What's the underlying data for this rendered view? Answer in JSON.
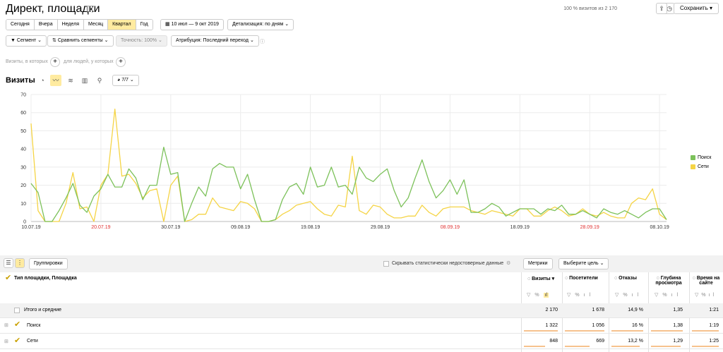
{
  "header": {
    "title": "Директ, площадки",
    "sampling": "100 % визитов из 2 170",
    "save": "Сохранить"
  },
  "periods": [
    "Сегодня",
    "Вчера",
    "Неделя",
    "Месяц",
    "Квартал",
    "Год"
  ],
  "date_range": "10 июл — 9 окт 2019",
  "detail": "Детализация: по дням",
  "filters": {
    "segment": "Сегмент",
    "compare": "Сравнить сегменты",
    "accuracy": "Точность: 100%",
    "attribution": "Атрибуция: Последний переход"
  },
  "visits_in": "Визиты, в которых",
  "people_in": "для людей, у которых",
  "chart_title": "Визиты",
  "series_count": "7/7",
  "legend": [
    "Поиск",
    "Сети"
  ],
  "chart_data": {
    "type": "line",
    "x": [
      "10.07.19",
      "11.07.19",
      "12.07.19",
      "13.07.19",
      "14.07.19",
      "15.07.19",
      "16.07.19",
      "17.07.19",
      "18.07.19",
      "19.07.19",
      "20.07.19",
      "21.07.19",
      "22.07.19",
      "23.07.19",
      "24.07.19",
      "25.07.19",
      "26.07.19",
      "27.07.19",
      "28.07.19",
      "29.07.19",
      "30.07.19",
      "31.07.19",
      "01.08.19",
      "02.08.19",
      "03.08.19",
      "04.08.19",
      "05.08.19",
      "06.08.19",
      "07.08.19",
      "08.08.19",
      "09.08.19",
      "10.08.19",
      "11.08.19",
      "12.08.19",
      "13.08.19",
      "14.08.19",
      "15.08.19",
      "16.08.19",
      "17.08.19",
      "18.08.19",
      "19.08.19",
      "20.08.19",
      "21.08.19",
      "22.08.19",
      "23.08.19",
      "24.08.19",
      "25.08.19",
      "26.08.19",
      "27.08.19",
      "28.08.19",
      "29.08.19",
      "30.08.19",
      "31.08.19",
      "01.09.19",
      "02.09.19",
      "03.09.19",
      "04.09.19",
      "05.09.19",
      "06.09.19",
      "07.09.19",
      "08.09.19",
      "09.09.19",
      "10.09.19",
      "11.09.19",
      "12.09.19",
      "13.09.19",
      "14.09.19",
      "15.09.19",
      "16.09.19",
      "17.09.19",
      "18.09.19",
      "19.09.19",
      "20.09.19",
      "21.09.19",
      "22.09.19",
      "23.09.19",
      "24.09.19",
      "25.09.19",
      "26.09.19",
      "27.09.19",
      "28.09.19",
      "29.09.19",
      "30.09.19",
      "01.10.19",
      "02.10.19",
      "03.10.19",
      "04.10.19",
      "05.10.19",
      "06.10.19",
      "07.10.19",
      "08.10.19",
      "09.10.19"
    ],
    "ylim": [
      0,
      70
    ],
    "yticks": [
      0,
      10,
      20,
      30,
      40,
      50,
      60,
      70
    ],
    "xticks": [
      "10.07.19",
      "20.07.19",
      "30.07.19",
      "09.08.19",
      "19.08.19",
      "29.08.19",
      "08.09.19",
      "18.09.19",
      "28.09.19",
      "08.10.19"
    ],
    "red_ticks": [
      "20.07.19",
      "08.09.19",
      "28.09.19"
    ],
    "series": [
      {
        "name": "Поиск",
        "color": "#7cc15a",
        "values": [
          21,
          16,
          0,
          0,
          6,
          13,
          21,
          9,
          5,
          14,
          18,
          26,
          19,
          19,
          29,
          24,
          12,
          20,
          20,
          41,
          26,
          27,
          0,
          10,
          19,
          14,
          29,
          32,
          30,
          30,
          18,
          26,
          12,
          0,
          0,
          1,
          12,
          19,
          21,
          15,
          30,
          19,
          20,
          30,
          19,
          20,
          15,
          30,
          24,
          22,
          26,
          29,
          17,
          8,
          13,
          24,
          34,
          22,
          13,
          17,
          23,
          15,
          23,
          5,
          5,
          7,
          10,
          8,
          3,
          5,
          7,
          7,
          7,
          4,
          7,
          6,
          9,
          4,
          4,
          6,
          4,
          2,
          7,
          5,
          4,
          6,
          4,
          2,
          5,
          7,
          7,
          1
        ]
      },
      {
        "name": "Сети",
        "color": "#f5d445",
        "values": [
          54,
          6,
          0,
          0,
          0,
          10,
          27,
          7,
          8,
          0,
          20,
          26,
          62,
          25,
          26,
          21,
          13,
          17,
          18,
          0,
          20,
          25,
          0,
          1,
          4,
          4,
          13,
          8,
          7,
          6,
          11,
          10,
          7,
          0,
          0,
          1,
          4,
          6,
          9,
          10,
          11,
          7,
          4,
          3,
          9,
          8,
          36,
          6,
          4,
          9,
          8,
          4,
          2,
          2,
          3,
          3,
          9,
          5,
          3,
          7,
          8,
          8,
          8,
          6,
          5,
          4,
          6,
          5,
          4,
          3,
          7,
          7,
          3,
          3,
          6,
          8,
          6,
          3,
          4,
          7,
          4,
          3,
          5,
          3,
          2,
          2,
          10,
          13,
          12,
          18,
          4,
          1
        ]
      }
    ]
  },
  "table": {
    "layout_btn": "Группировки",
    "hide_unreliable": "Скрывать статистически недостоверные данные",
    "metrics_btn": "Метрики",
    "goal_btn": "Выберите цель",
    "group_header": "Тип площадки, Площадка",
    "columns": [
      "Визиты",
      "Посетители",
      "Отказы",
      "Глубина просмотра",
      "Время на сайте"
    ],
    "total": {
      "label": "Итого и средние",
      "values": [
        "2 170",
        "1 678",
        "14,9 %",
        "1,35",
        "1:21"
      ]
    },
    "rows": [
      {
        "label": "Поиск",
        "values": [
          "1 322",
          "1 056",
          "16 %",
          "1,38",
          "1:19"
        ]
      },
      {
        "label": "Сети",
        "values": [
          "848",
          "669",
          "13,2 %",
          "1,29",
          "1:25"
        ]
      }
    ]
  }
}
